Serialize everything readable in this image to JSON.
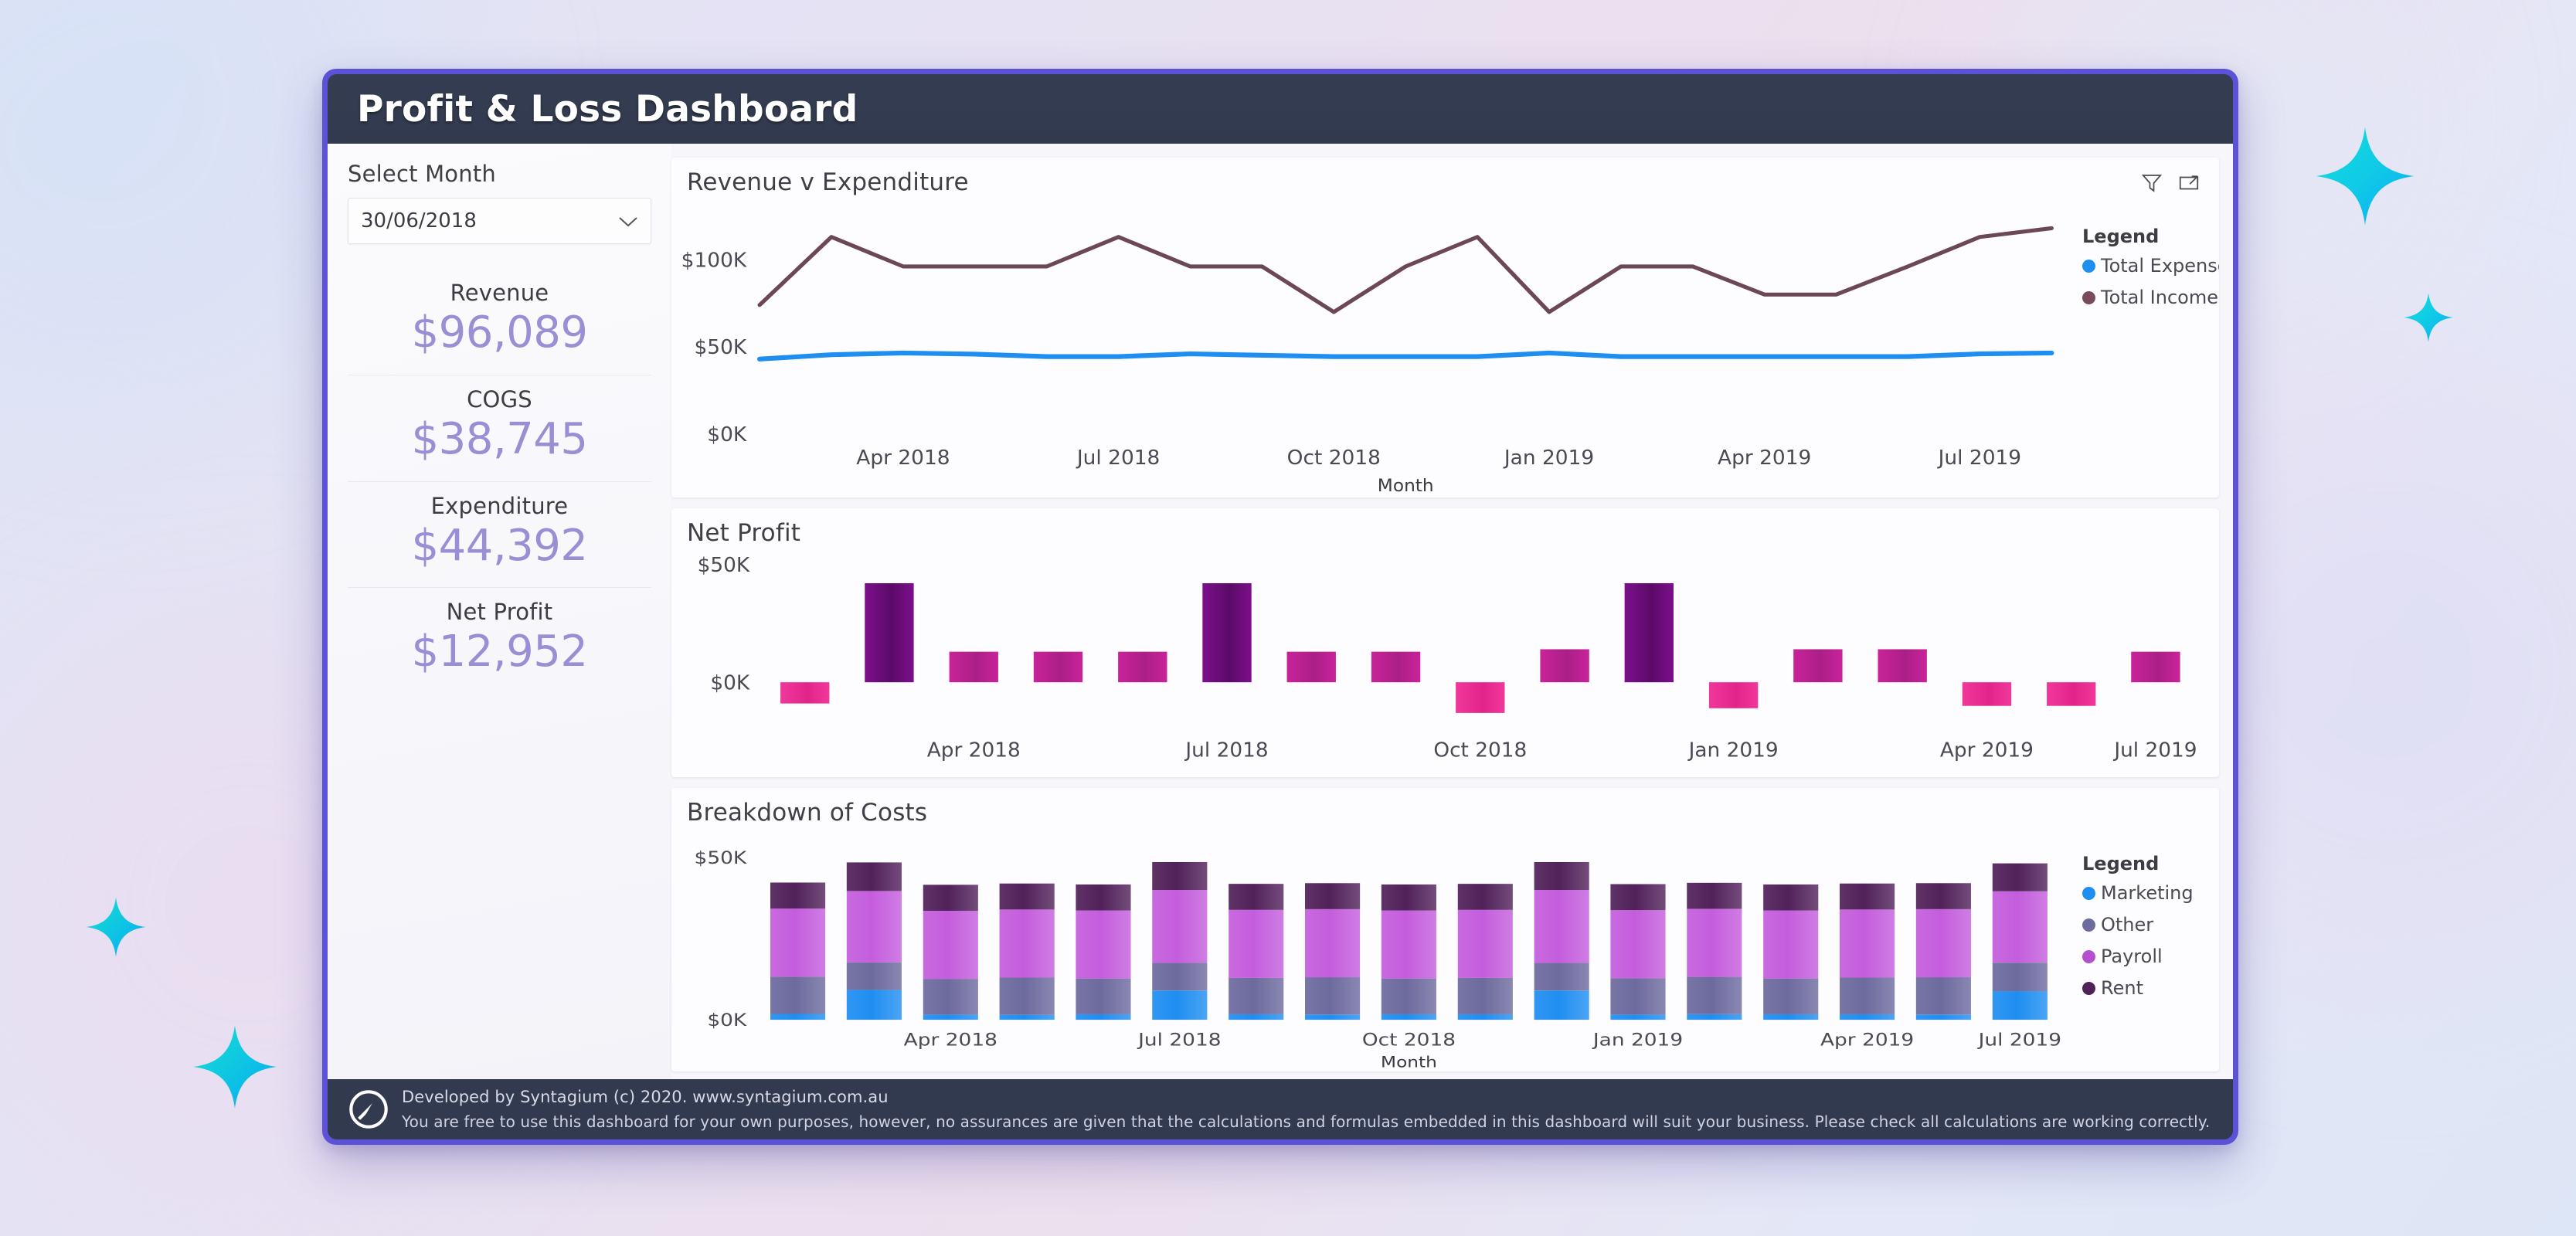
{
  "window": {
    "title": "Profit & Loss Dashboard",
    "accent_frame": "#5b52d8",
    "titlebar_bg": "#323a4f"
  },
  "sidebar": {
    "select_label": "Select Month",
    "month_select": {
      "value": "30/06/2018",
      "icon": "chevron-down-icon"
    },
    "kpis": [
      {
        "title": "Revenue",
        "value": "$96,089"
      },
      {
        "title": "COGS",
        "value": "$38,745"
      },
      {
        "title": "Expenditure",
        "value": "$44,392"
      },
      {
        "title": "Net Profit",
        "value": "$12,952"
      }
    ],
    "kpi_value_color": "#9a8fd4"
  },
  "cards": {
    "revenue_v_expenditure": {
      "title": "Revenue v Expenditure",
      "icons": [
        "filter-icon",
        "focus-mode-icon"
      ],
      "legend_title": "Legend"
    },
    "net_profit": {
      "title": "Net Profit"
    },
    "breakdown_of_costs": {
      "title": "Breakdown of Costs",
      "legend_title": "Legend"
    }
  },
  "footer": {
    "logo": "syntagium-logo-icon",
    "line1": "Developed by Syntagium (c) 2020.  www.syntagium.com.au",
    "line2": "You are free to use this dashboard for your own purposes, however, no assurances are given that the calculations and formulas embedded in this dashboard will suit your business.  Please check all calculations are working correctly."
  },
  "chart_data": [
    {
      "id": "revenue_v_expenditure",
      "type": "line",
      "title": "Revenue v Expenditure",
      "xlabel": "Month",
      "ylabel": "",
      "ylim": [
        0,
        130000
      ],
      "yticks": [
        0,
        50000,
        100000
      ],
      "ytick_labels": [
        "$0K",
        "$50K",
        "$100K"
      ],
      "grid": false,
      "legend_position": "right",
      "x": [
        "Feb 2018",
        "Mar 2018",
        "Apr 2018",
        "May 2018",
        "Jun 2018",
        "Jul 2018",
        "Aug 2018",
        "Sep 2018",
        "Oct 2018",
        "Nov 2018",
        "Dec 2018",
        "Jan 2019",
        "Feb 2019",
        "Mar 2019",
        "Apr 2019",
        "May 2019",
        "Jun 2019",
        "Jul 2019",
        "Aug 2019"
      ],
      "xtick_labels": [
        "Apr 2018",
        "Jul 2018",
        "Oct 2018",
        "Jan 2019",
        "Apr 2019",
        "Jul 2019"
      ],
      "series": [
        {
          "name": "Total Income",
          "color": "#6b4853",
          "values": [
            74000,
            113000,
            96089,
            96089,
            96089,
            113000,
            96089,
            96089,
            70000,
            96089,
            113000,
            70000,
            96089,
            96089,
            80000,
            80000,
            96089,
            113000,
            118000
          ]
        },
        {
          "name": "Total Expense",
          "color": "#1f8ef1",
          "values": [
            43000,
            45500,
            46500,
            45800,
            44392,
            44392,
            46000,
            45200,
            44392,
            44392,
            44392,
            46500,
            44392,
            44392,
            44392,
            44392,
            44392,
            46000,
            46500
          ]
        }
      ],
      "legend": [
        {
          "label": "Total Expense",
          "color": "#1f8ef1"
        },
        {
          "label": "Total Income",
          "color": "#7a4a58"
        }
      ]
    },
    {
      "id": "net_profit",
      "type": "bar",
      "title": "Net Profit",
      "xlabel": "",
      "ylim": [
        -18000,
        52000
      ],
      "yticks": [
        0,
        50000
      ],
      "ytick_labels": [
        "$0K",
        "$50K"
      ],
      "grid": false,
      "categories": [
        "Feb 2018",
        "Mar 2018",
        "Apr 2018",
        "May 2018",
        "Jun 2018",
        "Jul 2018",
        "Aug 2018",
        "Sep 2018",
        "Oct 2018",
        "Nov 2018",
        "Dec 2018",
        "Jan 2019",
        "Feb 2019",
        "Mar 2019",
        "Apr 2019",
        "May 2019",
        "Jun 2019"
      ],
      "xtick_labels": [
        "Apr 2018",
        "Jul 2018",
        "Oct 2018",
        "Jan 2019",
        "Apr 2019",
        "Jul 2019"
      ],
      "values": [
        -9000,
        42000,
        12952,
        12952,
        12952,
        42000,
        12952,
        12952,
        -13000,
        14000,
        42000,
        -11000,
        14000,
        14000,
        -10000,
        -10000,
        12952
      ],
      "bar_colors_rule": {
        "negative": "#e8348f",
        "mid": "#c42493",
        "high": "#6d0f7a"
      },
      "high_threshold": 30000
    },
    {
      "id": "breakdown_of_costs",
      "type": "bar",
      "stacked": true,
      "title": "Breakdown of Costs",
      "xlabel": "Month",
      "ylim": [
        0,
        52000
      ],
      "yticks": [
        0,
        50000
      ],
      "ytick_labels": [
        "$0K",
        "$50K"
      ],
      "grid": false,
      "legend_position": "right",
      "categories": [
        "Feb 2018",
        "Mar 2018",
        "Apr 2018",
        "May 2018",
        "Jun 2018",
        "Jul 2018",
        "Aug 2018",
        "Sep 2018",
        "Oct 2018",
        "Nov 2018",
        "Dec 2018",
        "Jan 2019",
        "Feb 2019",
        "Mar 2019",
        "Apr 2019",
        "May 2019",
        "Jun 2019"
      ],
      "xtick_labels": [
        "Apr 2018",
        "Jul 2018",
        "Oct 2018",
        "Jan 2019",
        "Apr 2019",
        "Jul 2019"
      ],
      "series": [
        {
          "name": "Marketing",
          "color": "#1f8ef1",
          "values": [
            1800,
            9200,
            1600,
            1500,
            1700,
            9000,
            1700,
            1600,
            1700,
            1700,
            9000,
            1600,
            1700,
            1700,
            1700,
            1600,
            8800
          ]
        },
        {
          "name": "Other",
          "color": "#6d6a9e",
          "values": [
            11500,
            8500,
            11000,
            11500,
            11000,
            8500,
            11200,
            11500,
            11000,
            11200,
            8500,
            11200,
            11500,
            11000,
            11300,
            11500,
            8800
          ]
        },
        {
          "name": "Payroll",
          "color": "#c45ddd",
          "values": [
            21000,
            22000,
            21000,
            21000,
            21000,
            22500,
            21000,
            21000,
            21000,
            21000,
            22500,
            21000,
            21000,
            21000,
            21000,
            21000,
            22000
          ]
        },
        {
          "name": "Rent",
          "color": "#51215a",
          "values": [
            8000,
            8800,
            8000,
            8000,
            8000,
            8600,
            8000,
            8000,
            8000,
            8000,
            8600,
            8000,
            8000,
            8000,
            8000,
            8000,
            8600
          ]
        }
      ],
      "legend": [
        {
          "label": "Marketing",
          "color": "#1f8ef1"
        },
        {
          "label": "Other",
          "color": "#6d6a9e"
        },
        {
          "label": "Payroll",
          "color": "#b44fd0"
        },
        {
          "label": "Rent",
          "color": "#51215a"
        }
      ]
    }
  ]
}
